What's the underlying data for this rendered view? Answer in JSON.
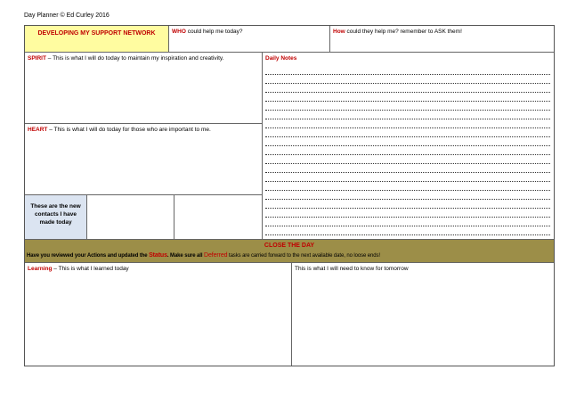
{
  "header": {
    "title": "Day Planner © Ed Curley 2016"
  },
  "top_row": {
    "section_title": "DEVELOPING MY SUPPORT NETWORK",
    "who_label": "WHO",
    "who_text": " could help me today?",
    "how_label": "How",
    "how_text": " could they help me? remember to ASK them!"
  },
  "spirit": {
    "label": "SPIRIT",
    "text": " – This is what I will do today to maintain my inspiration and creativity."
  },
  "heart": {
    "label": "HEART",
    "text": " – This is what I will do today for those who are important to me."
  },
  "daily_notes": {
    "title": "Daily Notes",
    "line_count": 19
  },
  "contacts": {
    "label": "These are the new contacts I have made today"
  },
  "close_day": {
    "title": "CLOSE THE DAY",
    "desc_part1": "Have you reviewed your Actions and updated the ",
    "status_word": "Status",
    "desc_part2": ". Make sure all ",
    "deferred_word": "Deferred",
    "desc_part3": " tasks are carried forward to the next available date, no loose ends!"
  },
  "learning": {
    "label": "Learning",
    "text": " – This is what I learned today"
  },
  "tomorrow": {
    "text": "This is what I will need to know for tomorrow"
  },
  "colors": {
    "title_bg": "#fffca0",
    "accent_red": "#c00000",
    "contacts_bg": "#dbe4f1",
    "close_bar_bg": "#9c8e48"
  }
}
